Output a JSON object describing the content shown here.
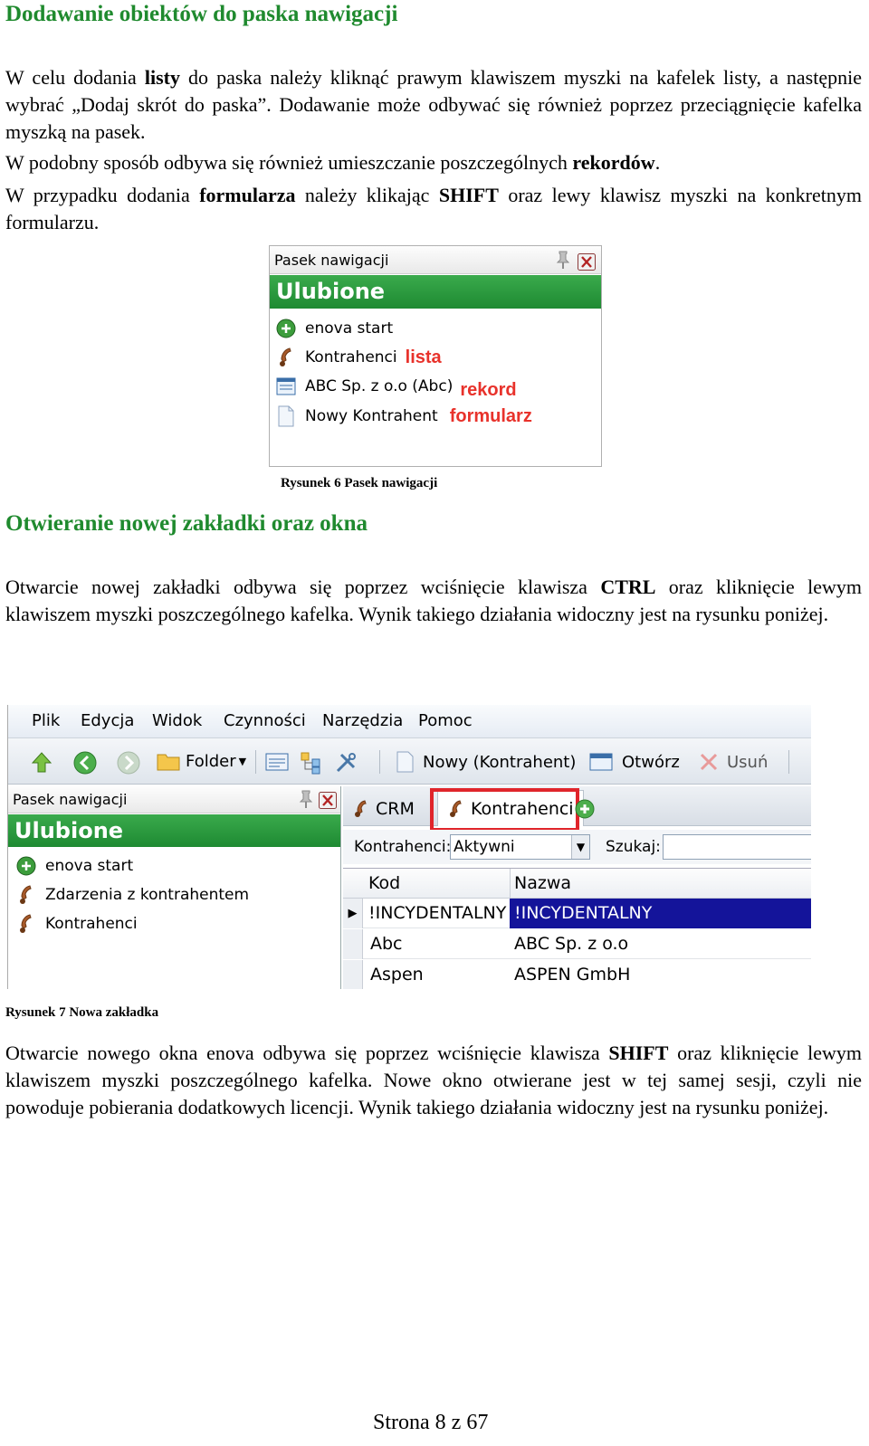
{
  "section1": {
    "heading": "Dodawanie obiektów do paska nawigacji",
    "p1": {
      "a": "W celu dodania ",
      "b": "listy",
      "c": " do paska należy kliknąć prawym klawiszem myszki na kafelek listy, a następnie wybrać „Dodaj skrót do paska”. Dodawanie może odbywać się również poprzez przeciągnięcie kafelka myszką na pasek."
    },
    "p2": {
      "a": "W podobny sposób odbywa się również umieszczanie poszczególnych ",
      "b": "rekordów",
      "c": "."
    },
    "p3": {
      "a": "W przypadku dodania ",
      "b": "formularza",
      "c": " należy klikając ",
      "d": "SHIFT",
      "e": " oraz lewy klawisz myszki na konkretnym formularzu."
    }
  },
  "figure6": {
    "panel_title": "Pasek nawigacji",
    "favorites": "Ulubione",
    "items": [
      {
        "label": "enova start",
        "icon": "enova-icon"
      },
      {
        "label": "Kontrahenci",
        "icon": "phone-icon",
        "tag": "lista"
      },
      {
        "label": "ABC Sp. z o.o (Abc)",
        "icon": "record-icon",
        "tag": "rekord"
      },
      {
        "label": "Nowy Kontrahent",
        "icon": "document-icon",
        "tag": "formularz"
      }
    ],
    "caption": "Rysunek 6 Pasek nawigacji"
  },
  "section2": {
    "heading": "Otwieranie nowej zakładki oraz okna",
    "p1": {
      "a": "Otwarcie nowej zakładki odbywa się poprzez wciśnięcie klawisza ",
      "b": "CTRL",
      "c": " oraz kliknięcie lewym klawiszem myszki poszczególnego kafelka. Wynik takiego działania widoczny jest na rysunku poniżej."
    }
  },
  "figure7": {
    "menu": [
      "Plik",
      "Edycja",
      "Widok",
      "Czynności",
      "Narzędzia",
      "Pomoc"
    ],
    "toolbar": {
      "folder": "Folder",
      "new": "Nowy (Kontrahent)",
      "open": "Otwórz",
      "delete": "Usuń"
    },
    "nav": {
      "panel_title": "Pasek nawigacji",
      "favorites": "Ulubione",
      "items": [
        "enova start",
        "Zdarzenia z kontrahentem",
        "Kontrahenci"
      ]
    },
    "tabs": [
      "CRM",
      "Kontrahenci"
    ],
    "filter": {
      "label": "Kontrahenci:",
      "value": "Aktywni",
      "search_label": "Szukaj:"
    },
    "grid": {
      "columns": [
        "Kod",
        "Nazwa"
      ],
      "rows": [
        {
          "kod": "!INCYDENTALNY",
          "nazwa": "!INCYDENTALNY"
        },
        {
          "kod": "Abc",
          "nazwa": "ABC Sp. z o.o"
        },
        {
          "kod": "Aspen",
          "nazwa": "ASPEN GmbH"
        }
      ]
    },
    "caption": "Rysunek 7 Nowa zakładka",
    "colors": {
      "highlight": "#e0252b",
      "selected_row": "#14149a",
      "green": "#1e8a32"
    }
  },
  "section3": {
    "p1": {
      "a": "Otwarcie nowego okna enova odbywa się poprzez wciśnięcie klawisza ",
      "b": "SHIFT",
      "c": " oraz kliknięcie lewym klawiszem myszki poszczególnego kafelka. Nowe okno otwierane jest w tej samej sesji, czyli nie powoduje pobierania dodatkowych licencji. Wynik takiego działania widoczny jest na rysunku poniżej."
    }
  },
  "footer": {
    "page": "Strona 8 z 67"
  }
}
